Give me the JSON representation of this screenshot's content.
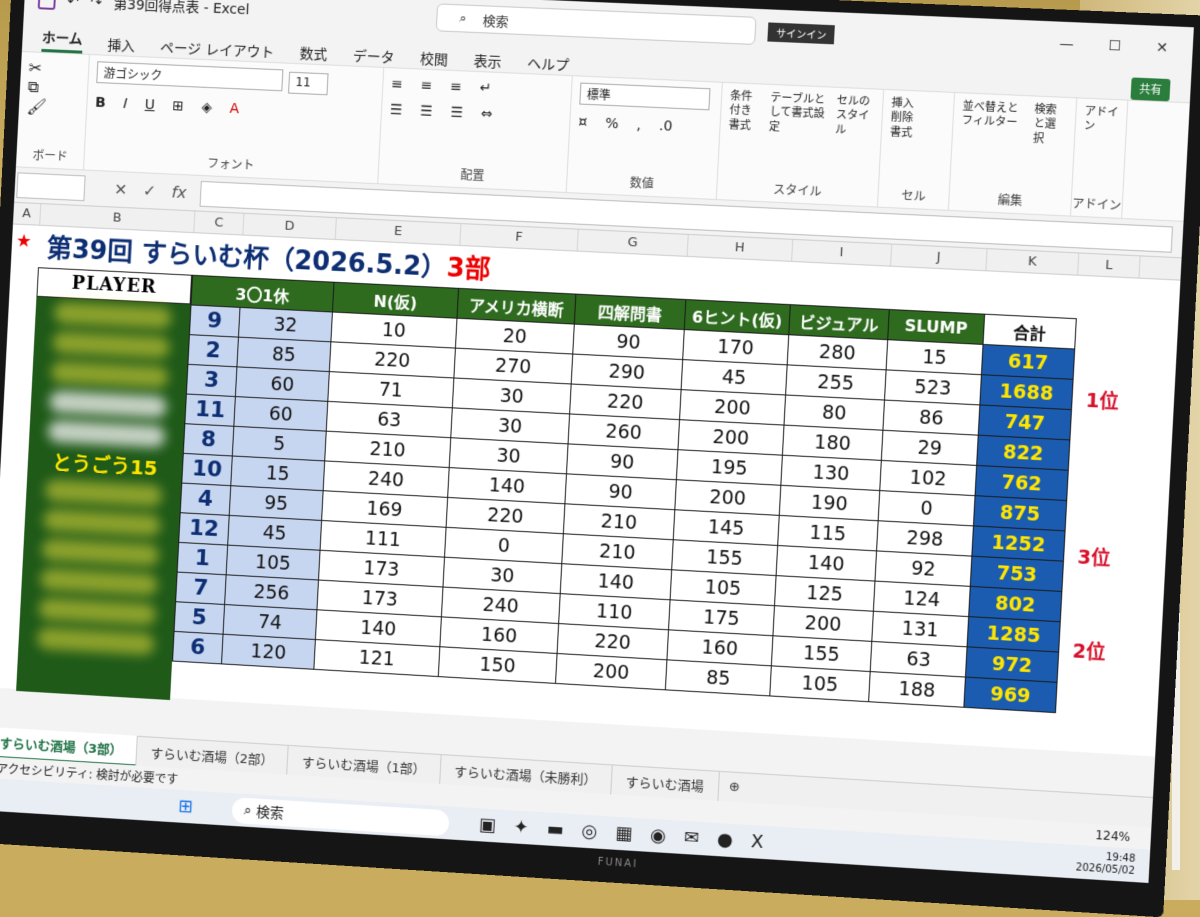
{
  "window": {
    "title": "第39回得点表 - Excel",
    "search_label": "検索",
    "signin": "サインイン",
    "share": "共有"
  },
  "tabs": [
    "ホーム",
    "挿入",
    "ページ レイアウト",
    "数式",
    "データ",
    "校閲",
    "表示",
    "ヘルプ"
  ],
  "ribbon": {
    "clipboard_label": "ボード",
    "font_name": "游ゴシック",
    "font_size": "11",
    "font_group": "フォント",
    "align_group": "配置",
    "number_format": "標準",
    "number_group": "数値",
    "style_group": "スタイル",
    "cond_format": "条件付き書式",
    "table_format": "テーブルとして書式設定",
    "cell_style": "セルのスタイル",
    "insert": "挿入",
    "delete": "削除",
    "format": "書式",
    "cells_group": "セル",
    "sort": "並べ替えとフィルター",
    "find": "検索と選択",
    "edit_group": "編集",
    "addin": "アドイン",
    "addin_group": "アドイン"
  },
  "columns": [
    "A",
    "B",
    "C",
    "D",
    "E",
    "F",
    "G",
    "H",
    "I",
    "J",
    "K",
    "L"
  ],
  "sheet": {
    "title_main": "第39回 すらいむ杯（2026.5.2）",
    "title_part": "3部",
    "player_header": "PLAYER",
    "visible_player": "とうごう15",
    "headers": [
      "3〇1休",
      "N(仮)",
      "アメリカ横断",
      "四解問書",
      "6ヒント(仮)",
      "ビジュアル",
      "SLUMP",
      "合計"
    ],
    "rows": [
      {
        "seq": "9",
        "d": "32",
        "e": "10",
        "f": "20",
        "g": "90",
        "h": "170",
        "i": "280",
        "j": "15",
        "total": "617",
        "rank": ""
      },
      {
        "seq": "2",
        "d": "85",
        "e": "220",
        "f": "270",
        "g": "290",
        "h": "45",
        "i": "255",
        "j": "523",
        "total": "1688",
        "rank": "1位"
      },
      {
        "seq": "3",
        "d": "60",
        "e": "71",
        "f": "30",
        "g": "220",
        "h": "200",
        "i": "80",
        "j": "86",
        "total": "747",
        "rank": ""
      },
      {
        "seq": "11",
        "d": "60",
        "e": "63",
        "f": "30",
        "g": "260",
        "h": "200",
        "i": "180",
        "j": "29",
        "total": "822",
        "rank": ""
      },
      {
        "seq": "8",
        "d": "5",
        "e": "210",
        "f": "30",
        "g": "90",
        "h": "195",
        "i": "130",
        "j": "102",
        "total": "762",
        "rank": ""
      },
      {
        "seq": "10",
        "d": "15",
        "e": "240",
        "f": "140",
        "g": "90",
        "h": "200",
        "i": "190",
        "j": "0",
        "total": "875",
        "rank": ""
      },
      {
        "seq": "4",
        "d": "95",
        "e": "169",
        "f": "220",
        "g": "210",
        "h": "145",
        "i": "115",
        "j": "298",
        "total": "1252",
        "rank": "3位"
      },
      {
        "seq": "12",
        "d": "45",
        "e": "111",
        "f": "0",
        "g": "210",
        "h": "155",
        "i": "140",
        "j": "92",
        "total": "753",
        "rank": ""
      },
      {
        "seq": "1",
        "d": "105",
        "e": "173",
        "f": "30",
        "g": "140",
        "h": "105",
        "i": "125",
        "j": "124",
        "total": "802",
        "rank": ""
      },
      {
        "seq": "7",
        "d": "256",
        "e": "173",
        "f": "240",
        "g": "110",
        "h": "175",
        "i": "200",
        "j": "131",
        "total": "1285",
        "rank": "2位"
      },
      {
        "seq": "5",
        "d": "74",
        "e": "140",
        "f": "160",
        "g": "220",
        "h": "160",
        "i": "155",
        "j": "63",
        "total": "972",
        "rank": ""
      },
      {
        "seq": "6",
        "d": "120",
        "e": "121",
        "f": "150",
        "g": "200",
        "h": "85",
        "i": "105",
        "j": "188",
        "total": "969",
        "rank": ""
      }
    ]
  },
  "sheet_tabs": [
    "すらいむ酒場（3部）",
    "すらいむ酒場（2部）",
    "すらいむ酒場（1部）",
    "すらいむ酒場（未勝利）",
    "すらいむ酒場"
  ],
  "status": {
    "accessibility": "アクセシビリティ: 検討が必要です",
    "zoom": "124%"
  },
  "taskbar": {
    "search": "検索",
    "time": "19:48",
    "date": "2026/05/02"
  },
  "tv_brand": "FUNAI"
}
